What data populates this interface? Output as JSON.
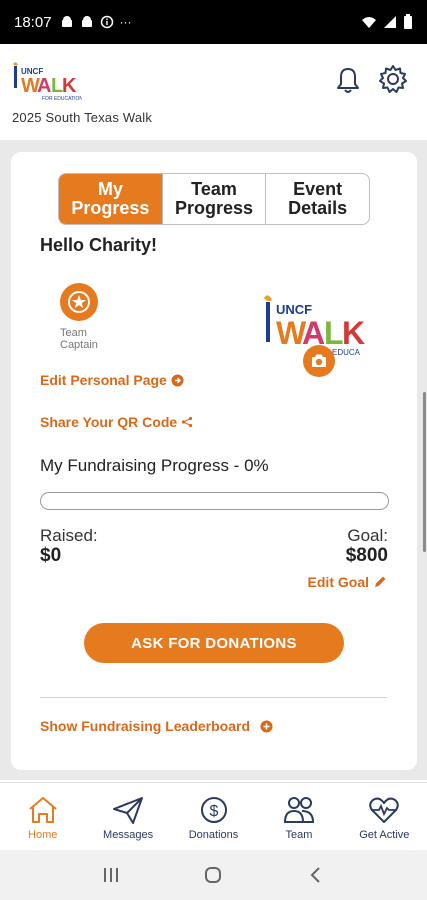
{
  "status_bar": {
    "time": "18:07",
    "overflow": "···"
  },
  "header": {
    "event_name": "2025 South Texas Walk",
    "logo_text": "UNCF WALK",
    "logo_sub": "FOR EDUCATION"
  },
  "tabs": [
    {
      "label": "My\nProgress",
      "active": true
    },
    {
      "label": "Team\nProgress",
      "active": false
    },
    {
      "label": "Event\nDetails",
      "active": false
    }
  ],
  "greeting": "Hello Charity!",
  "captain_label": "Team\nCaptain",
  "links": {
    "edit_personal_page": "Edit Personal Page",
    "share_qr": "Share Your QR Code",
    "edit_goal": "Edit Goal",
    "leaderboard": "Show Fundraising Leaderboard"
  },
  "fundraising": {
    "title": "My Fundraising Progress - 0%",
    "progress_fraction": 0,
    "raised_label": "Raised:",
    "raised_value": "$0",
    "goal_label": "Goal:",
    "goal_value": "$800"
  },
  "ask_button": "ASK FOR DONATIONS",
  "nav": [
    {
      "label": "Home",
      "icon": "home-icon",
      "active": true
    },
    {
      "label": "Messages",
      "icon": "paper-plane-icon",
      "active": false
    },
    {
      "label": "Donations",
      "icon": "dollar-icon",
      "active": false
    },
    {
      "label": "Team",
      "icon": "team-icon",
      "active": false
    },
    {
      "label": "Get Active",
      "icon": "heart-pulse-icon",
      "active": false
    }
  ],
  "colors": {
    "accent": "#e57a1f",
    "nav_ink": "#2c3a5b"
  }
}
